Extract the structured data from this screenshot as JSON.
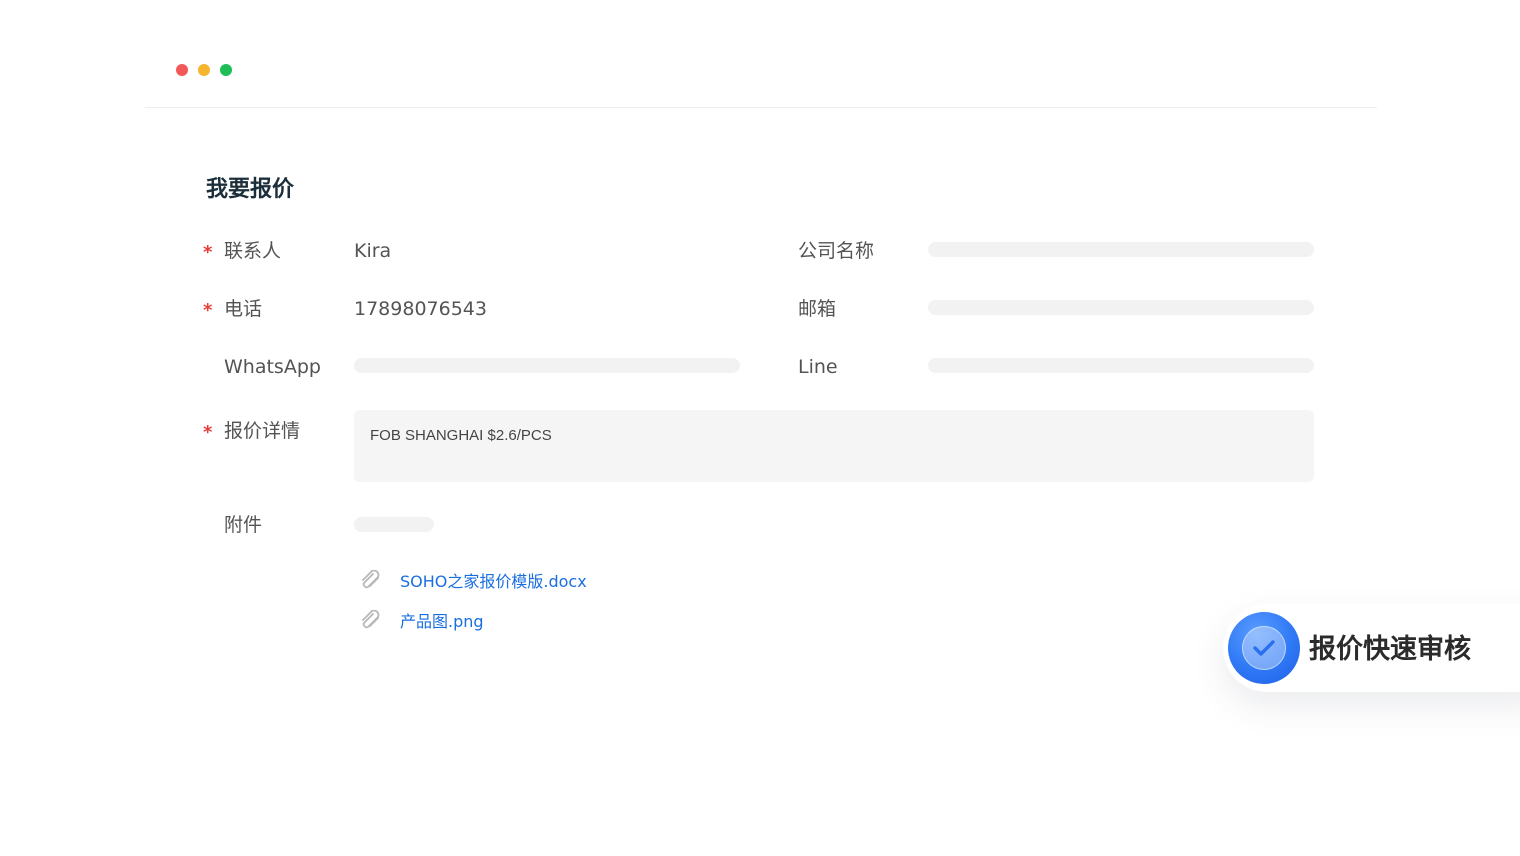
{
  "window": {
    "controls": {
      "close_color": "#f25858",
      "minimize_color": "#f5b52e",
      "maximize_color": "#1fbd55"
    }
  },
  "form": {
    "title": "我要报价",
    "fields": {
      "contact": {
        "label": "联系人",
        "required": true,
        "value": "Kira"
      },
      "company": {
        "label": "公司名称",
        "required": false,
        "value": ""
      },
      "phone": {
        "label": "电话",
        "required": true,
        "value": "17898076543"
      },
      "email": {
        "label": "邮箱",
        "required": false,
        "value": ""
      },
      "whatsapp": {
        "label": "WhatsApp",
        "required": false,
        "value": ""
      },
      "line": {
        "label": "Line",
        "required": false,
        "value": ""
      },
      "quote_details": {
        "label": "报价详情",
        "required": true,
        "value": "FOB SHANGHAI $2.6/PCS"
      },
      "attachments": {
        "label": "附件",
        "files": [
          {
            "name": "SOHO之家报价模版.docx",
            "icon": "paperclip-icon"
          },
          {
            "name": "产品图.png",
            "icon": "paperclip-icon"
          }
        ]
      }
    },
    "required_marker": "*"
  },
  "badge": {
    "text": "报价快速审核",
    "icon": "check-circle-icon",
    "accent_color": "#2f78f5"
  },
  "colors": {
    "link": "#1a6fe0",
    "required": "#ea3b3b",
    "placeholder_bar": "#f2f2f2"
  }
}
